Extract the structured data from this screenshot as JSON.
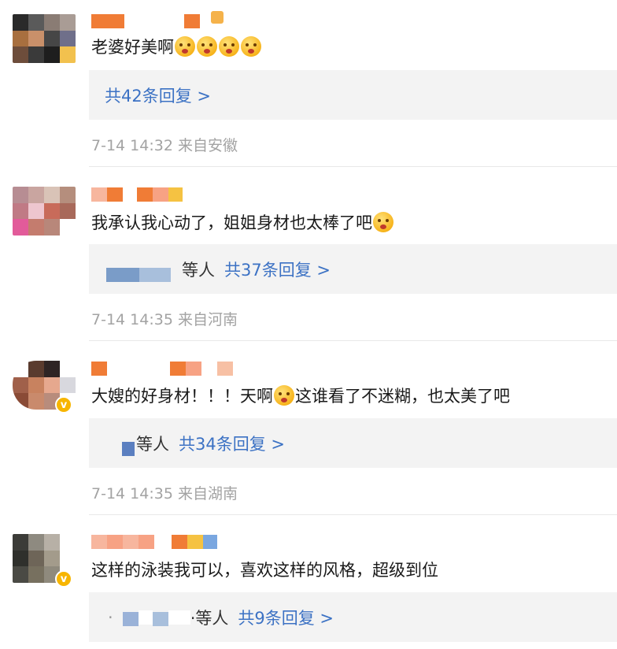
{
  "comments": [
    {
      "text": "老婆好美啊",
      "emoji_count": 4,
      "reply_link": "共42条回复 >",
      "reply_prefix": "",
      "time": "7-14 14:32",
      "location": "来自安徽"
    },
    {
      "text": "我承认我心动了，姐姐身材也太棒了吧",
      "reply_prefix": "等人",
      "reply_link": "共37条回复 >",
      "time": "7-14 14:35",
      "location": "来自河南"
    },
    {
      "text_a": "大嫂的好身材！！！天啊",
      "text_b": "这谁看了不迷糊，也太美了吧",
      "reply_prefix": "等人",
      "reply_link": "共34条回复 >",
      "time": "7-14 14:35",
      "location": "来自湖南"
    },
    {
      "text": "这样的泳装我可以，喜欢这样的风格，超级到位",
      "reply_prefix": "·等人",
      "reply_link": "共9条回复 >"
    }
  ],
  "icons": {
    "verified": "verified-v-icon",
    "emoji": "surprised-face-emoji-icon"
  },
  "colors": {
    "link": "#3c72c4",
    "meta": "#a3a3a3",
    "reply_bg": "#f3f3f3",
    "verified": "#f7b500"
  }
}
